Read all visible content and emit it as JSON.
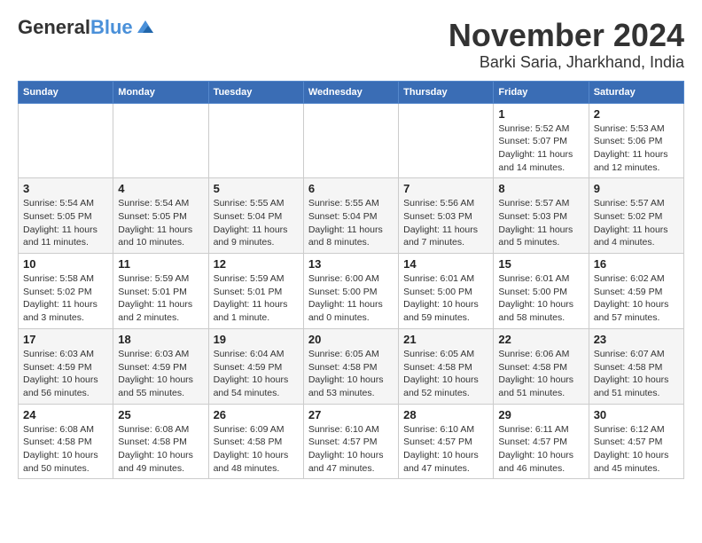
{
  "header": {
    "logo_line1": "General",
    "logo_line2": "Blue",
    "month_title": "November 2024",
    "subtitle": "Barki Saria, Jharkhand, India"
  },
  "weekdays": [
    "Sunday",
    "Monday",
    "Tuesday",
    "Wednesday",
    "Thursday",
    "Friday",
    "Saturday"
  ],
  "weeks": [
    [
      {
        "day": "",
        "detail": ""
      },
      {
        "day": "",
        "detail": ""
      },
      {
        "day": "",
        "detail": ""
      },
      {
        "day": "",
        "detail": ""
      },
      {
        "day": "",
        "detail": ""
      },
      {
        "day": "1",
        "detail": "Sunrise: 5:52 AM\nSunset: 5:07 PM\nDaylight: 11 hours and 14 minutes."
      },
      {
        "day": "2",
        "detail": "Sunrise: 5:53 AM\nSunset: 5:06 PM\nDaylight: 11 hours and 12 minutes."
      }
    ],
    [
      {
        "day": "3",
        "detail": "Sunrise: 5:54 AM\nSunset: 5:05 PM\nDaylight: 11 hours and 11 minutes."
      },
      {
        "day": "4",
        "detail": "Sunrise: 5:54 AM\nSunset: 5:05 PM\nDaylight: 11 hours and 10 minutes."
      },
      {
        "day": "5",
        "detail": "Sunrise: 5:55 AM\nSunset: 5:04 PM\nDaylight: 11 hours and 9 minutes."
      },
      {
        "day": "6",
        "detail": "Sunrise: 5:55 AM\nSunset: 5:04 PM\nDaylight: 11 hours and 8 minutes."
      },
      {
        "day": "7",
        "detail": "Sunrise: 5:56 AM\nSunset: 5:03 PM\nDaylight: 11 hours and 7 minutes."
      },
      {
        "day": "8",
        "detail": "Sunrise: 5:57 AM\nSunset: 5:03 PM\nDaylight: 11 hours and 5 minutes."
      },
      {
        "day": "9",
        "detail": "Sunrise: 5:57 AM\nSunset: 5:02 PM\nDaylight: 11 hours and 4 minutes."
      }
    ],
    [
      {
        "day": "10",
        "detail": "Sunrise: 5:58 AM\nSunset: 5:02 PM\nDaylight: 11 hours and 3 minutes."
      },
      {
        "day": "11",
        "detail": "Sunrise: 5:59 AM\nSunset: 5:01 PM\nDaylight: 11 hours and 2 minutes."
      },
      {
        "day": "12",
        "detail": "Sunrise: 5:59 AM\nSunset: 5:01 PM\nDaylight: 11 hours and 1 minute."
      },
      {
        "day": "13",
        "detail": "Sunrise: 6:00 AM\nSunset: 5:00 PM\nDaylight: 11 hours and 0 minutes."
      },
      {
        "day": "14",
        "detail": "Sunrise: 6:01 AM\nSunset: 5:00 PM\nDaylight: 10 hours and 59 minutes."
      },
      {
        "day": "15",
        "detail": "Sunrise: 6:01 AM\nSunset: 5:00 PM\nDaylight: 10 hours and 58 minutes."
      },
      {
        "day": "16",
        "detail": "Sunrise: 6:02 AM\nSunset: 4:59 PM\nDaylight: 10 hours and 57 minutes."
      }
    ],
    [
      {
        "day": "17",
        "detail": "Sunrise: 6:03 AM\nSunset: 4:59 PM\nDaylight: 10 hours and 56 minutes."
      },
      {
        "day": "18",
        "detail": "Sunrise: 6:03 AM\nSunset: 4:59 PM\nDaylight: 10 hours and 55 minutes."
      },
      {
        "day": "19",
        "detail": "Sunrise: 6:04 AM\nSunset: 4:59 PM\nDaylight: 10 hours and 54 minutes."
      },
      {
        "day": "20",
        "detail": "Sunrise: 6:05 AM\nSunset: 4:58 PM\nDaylight: 10 hours and 53 minutes."
      },
      {
        "day": "21",
        "detail": "Sunrise: 6:05 AM\nSunset: 4:58 PM\nDaylight: 10 hours and 52 minutes."
      },
      {
        "day": "22",
        "detail": "Sunrise: 6:06 AM\nSunset: 4:58 PM\nDaylight: 10 hours and 51 minutes."
      },
      {
        "day": "23",
        "detail": "Sunrise: 6:07 AM\nSunset: 4:58 PM\nDaylight: 10 hours and 51 minutes."
      }
    ],
    [
      {
        "day": "24",
        "detail": "Sunrise: 6:08 AM\nSunset: 4:58 PM\nDaylight: 10 hours and 50 minutes."
      },
      {
        "day": "25",
        "detail": "Sunrise: 6:08 AM\nSunset: 4:58 PM\nDaylight: 10 hours and 49 minutes."
      },
      {
        "day": "26",
        "detail": "Sunrise: 6:09 AM\nSunset: 4:58 PM\nDaylight: 10 hours and 48 minutes."
      },
      {
        "day": "27",
        "detail": "Sunrise: 6:10 AM\nSunset: 4:57 PM\nDaylight: 10 hours and 47 minutes."
      },
      {
        "day": "28",
        "detail": "Sunrise: 6:10 AM\nSunset: 4:57 PM\nDaylight: 10 hours and 47 minutes."
      },
      {
        "day": "29",
        "detail": "Sunrise: 6:11 AM\nSunset: 4:57 PM\nDaylight: 10 hours and 46 minutes."
      },
      {
        "day": "30",
        "detail": "Sunrise: 6:12 AM\nSunset: 4:57 PM\nDaylight: 10 hours and 45 minutes."
      }
    ]
  ]
}
